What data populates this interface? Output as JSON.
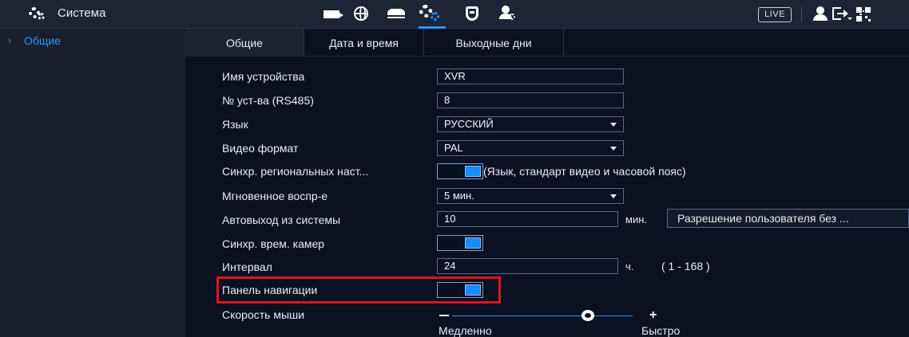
{
  "header": {
    "title": "Система",
    "icons": [
      "display-icon",
      "network-icon",
      "storage-icon",
      "system-icon",
      "security-icon",
      "account-icon"
    ],
    "live_label": "LIVE",
    "right_icons": [
      "user-icon",
      "logout-icon",
      "qr-code-icon"
    ],
    "accent_color": "#2a95ff"
  },
  "sidebar": {
    "items": [
      {
        "label": "Общие",
        "active": true
      }
    ]
  },
  "tabs": [
    {
      "label": "Общие",
      "active": true
    },
    {
      "label": "Дата и время",
      "active": false
    },
    {
      "label": "Выходные дни",
      "active": false
    }
  ],
  "form": {
    "device_name": {
      "label": "Имя устройства",
      "value": "XVR"
    },
    "device_no": {
      "label": "№ уст-ва (RS485)",
      "value": "8"
    },
    "language": {
      "label": "Язык",
      "value": "РУССКИЙ"
    },
    "video_format": {
      "label": "Видео формат",
      "value": "PAL"
    },
    "region_sync": {
      "label": "Синхр. региональных наст...",
      "enabled": true,
      "description": "(Язык, стандарт видео и часовой пояс)"
    },
    "instant_playback": {
      "label": "Мгновенное воспр-е",
      "value": "5 мин."
    },
    "auto_logout": {
      "label": "Автовыход из системы",
      "value": "10",
      "unit": "мин.",
      "permission_button": "Разрешение пользователя без ..."
    },
    "camera_time_sync": {
      "label": "Синхр. врем. камер",
      "enabled": true
    },
    "interval": {
      "label": "Интервал",
      "value": "24",
      "unit": "ч.",
      "range": "( 1 - 168 )"
    },
    "nav_panel": {
      "label": "Панель навигации",
      "enabled": true
    },
    "mouse_speed": {
      "label": "Скорость мыши",
      "min_label": "Медленно",
      "max_label": "Быстро",
      "minus": "−",
      "plus": "+",
      "level": 0.75
    }
  },
  "highlight_color": "#e0141a"
}
